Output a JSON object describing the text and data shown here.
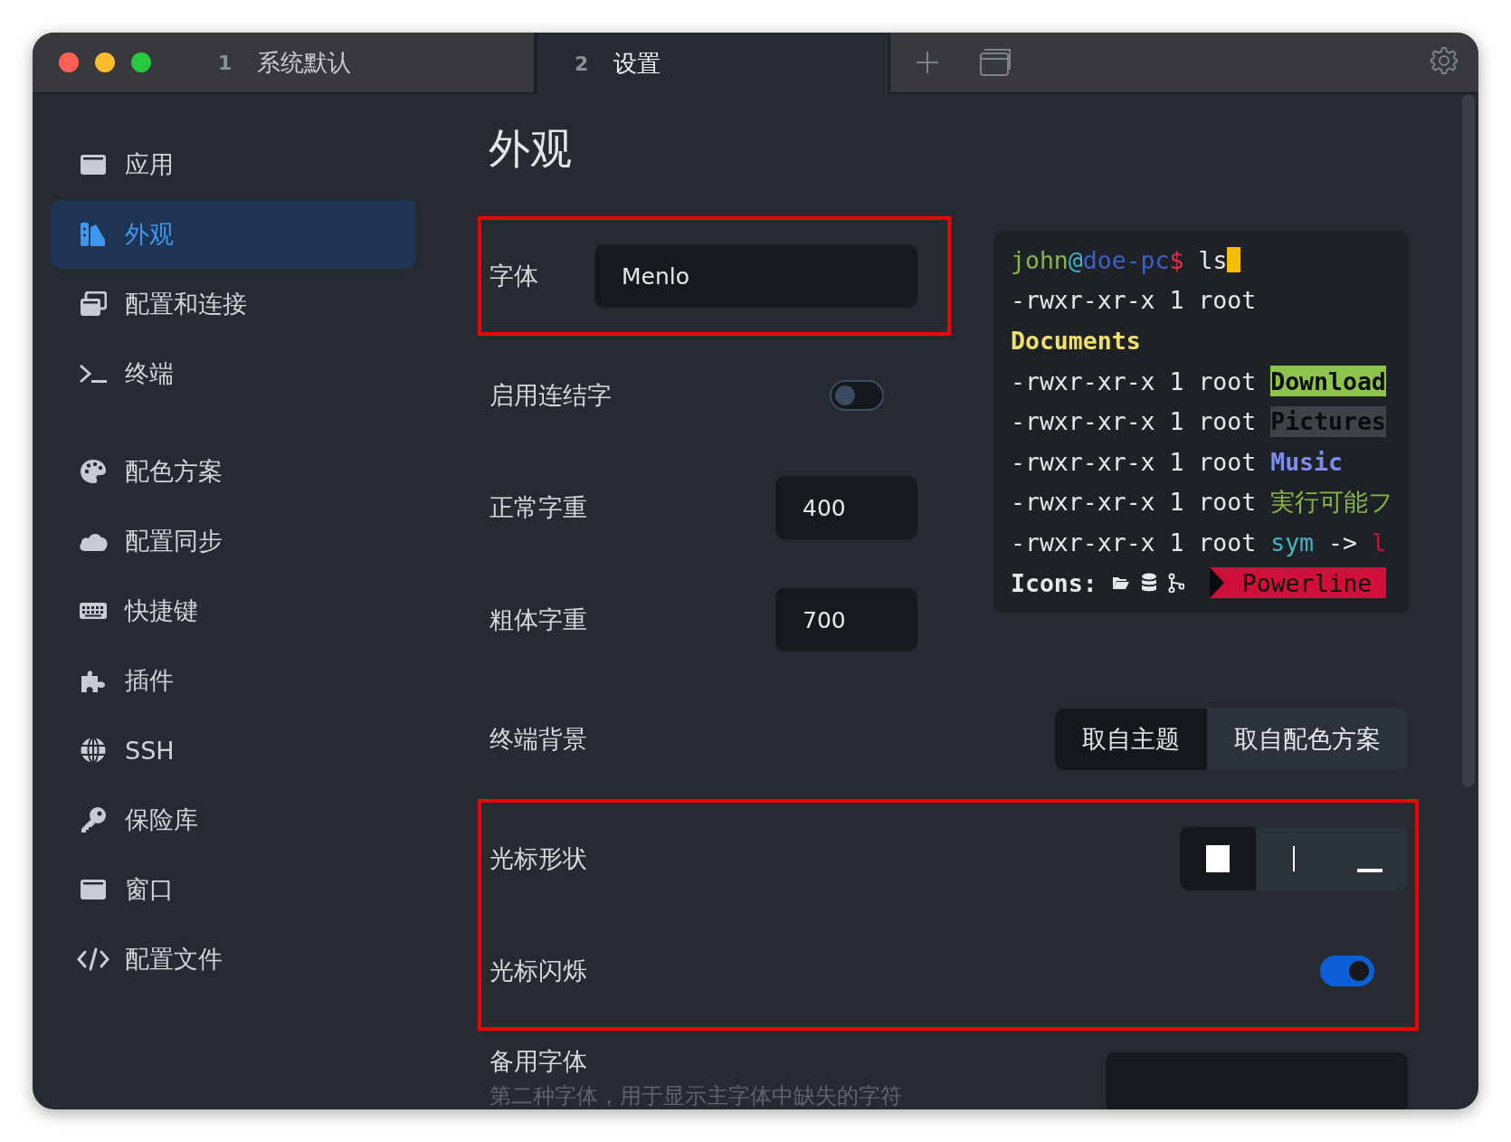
{
  "tabs": [
    {
      "number": "1",
      "title": "系统默认",
      "selected": false
    },
    {
      "number": "2",
      "title": "设置",
      "selected": true
    }
  ],
  "sidebar": {
    "groups": [
      [
        {
          "label": "应用",
          "selected": false
        },
        {
          "label": "外观",
          "selected": true
        },
        {
          "label": "配置和连接",
          "selected": false
        },
        {
          "label": "终端",
          "selected": false
        }
      ],
      [
        {
          "label": "配色方案",
          "selected": false
        },
        {
          "label": "配置同步",
          "selected": false
        },
        {
          "label": "快捷键",
          "selected": false
        },
        {
          "label": "插件",
          "selected": false
        },
        {
          "label": "SSH",
          "selected": false
        },
        {
          "label": "保险库",
          "selected": false
        },
        {
          "label": "窗口",
          "selected": false
        },
        {
          "label": "配置文件",
          "selected": false
        }
      ]
    ]
  },
  "page": {
    "title": "外观",
    "left_groups": [
      {
        "highlighted": true,
        "rows": [
          {
            "kind": "text-input",
            "label": "字体",
            "value": "Menlo"
          }
        ]
      },
      {
        "highlighted": false,
        "rows": [
          {
            "kind": "toggle",
            "label": "启用连结字",
            "on": false
          },
          {
            "kind": "number-input",
            "label": "正常字重",
            "value": "400"
          },
          {
            "kind": "number-input",
            "label": "粗体字重",
            "value": "700"
          }
        ]
      }
    ],
    "preview": {
      "lines": [
        [
          {
            "kind": "text",
            "text": "john",
            "color": "#8ab54a"
          },
          {
            "kind": "text",
            "text": "@",
            "color": "#3fb6c6"
          },
          {
            "kind": "text",
            "text": "doe-pc",
            "color": "#3d5fd0"
          },
          {
            "kind": "text",
            "text": "$",
            "color": "#e0304a"
          },
          {
            "kind": "text",
            "text": " ls",
            "color": "#e6e8ea"
          },
          {
            "kind": "cursor",
            "color": "#f5be00"
          }
        ],
        [
          {
            "kind": "text",
            "text": "-rwxr-xr-x 1 root",
            "color": "#e6e8ea"
          }
        ],
        [
          {
            "kind": "text",
            "text": "Documents",
            "color": "#f0e068",
            "bold": true
          }
        ],
        [
          {
            "kind": "text",
            "text": "-rwxr-xr-x 1 root ",
            "color": "#e6e8ea"
          },
          {
            "kind": "highlight",
            "text": "Download",
            "color": "#8dc34a",
            "bold": true
          }
        ],
        [
          {
            "kind": "text",
            "text": "-rwxr-xr-x 1 root ",
            "color": "#e6e8ea"
          },
          {
            "kind": "highlight",
            "text": "Pictures",
            "color": "#3d4348",
            "bold": true
          }
        ],
        [
          {
            "kind": "text",
            "text": "-rwxr-xr-x 1 root ",
            "color": "#e6e8ea"
          },
          {
            "kind": "text",
            "text": "Music",
            "color": "#7d8cf0",
            "bold": true
          }
        ],
        [
          {
            "kind": "text",
            "text": "-rwxr-xr-x 1 root ",
            "color": "#e6e8ea"
          },
          {
            "kind": "text",
            "text": "実行可能フ",
            "color": "#8ab54a"
          }
        ],
        [
          {
            "kind": "text",
            "text": "-rwxr-xr-x 1 root ",
            "color": "#e6e8ea"
          },
          {
            "kind": "text",
            "text": "sym",
            "color": "#3fb6c6"
          },
          {
            "kind": "text",
            "text": " -> ",
            "color": "#e6e8ea"
          },
          {
            "kind": "text",
            "text": "l",
            "color": "#c8103a"
          }
        ],
        [
          {
            "kind": "text",
            "text": "Icons:",
            "color": "#e6e8ea",
            "bold": true
          },
          {
            "kind": "icons"
          },
          {
            "kind": "powerline",
            "text": "Powerline",
            "color": "#d0103a"
          }
        ]
      ]
    },
    "groups": [
      {
        "highlighted": false,
        "rows": [
          {
            "kind": "segmented",
            "label": "终端背景",
            "options": [
              {
                "label": "取自主题",
                "selected": true
              },
              {
                "label": "取自配色方案",
                "selected": false
              }
            ]
          }
        ]
      },
      {
        "highlighted": true,
        "rows": [
          {
            "kind": "shapes",
            "label": "光标形状",
            "options": [
              {
                "kind": "block",
                "selected": true
              },
              {
                "kind": "beam",
                "selected": false
              },
              {
                "kind": "underline",
                "selected": false
              }
            ]
          },
          {
            "kind": "toggle",
            "label": "光标闪烁",
            "on": true
          }
        ]
      },
      {
        "highlighted": false,
        "rows": [
          {
            "kind": "fallback",
            "label": "备用字体",
            "description": "第二种字体，用于显示主字体中缺失的字符"
          }
        ]
      }
    ]
  }
}
